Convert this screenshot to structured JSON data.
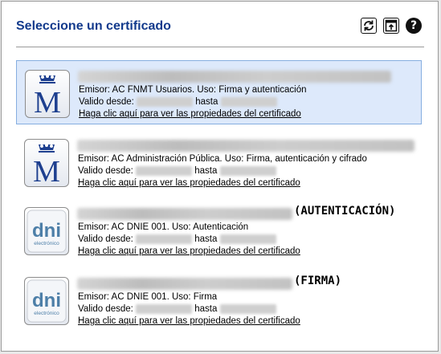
{
  "header": {
    "title": "Seleccione un certificado",
    "icons": [
      "refresh-icon",
      "export-icon",
      "help-icon"
    ],
    "help_glyph": "?"
  },
  "certificates": [
    {
      "issuer_line": "Emisor: AC FNMT Usuarios. Uso: Firma y autenticación",
      "valid_from_label": "Valido desde:",
      "until_label": "hasta",
      "link": "Haga clic aquí para ver las propiedades del certificado",
      "suffix": "",
      "badge": "fnmt-logo",
      "selected": true
    },
    {
      "issuer_line": "Emisor: AC Administración Pública. Uso: Firma, autenticación y cifrado",
      "valid_from_label": "Valido desde:",
      "until_label": "hasta",
      "link": "Haga clic aquí para ver las propiedades del certificado",
      "suffix": "",
      "badge": "fnmt-logo",
      "selected": false
    },
    {
      "issuer_line": "Emisor: AC DNIE 001. Uso: Autenticación",
      "valid_from_label": "Valido desde:",
      "until_label": "hasta",
      "link": "Haga clic aquí para ver las propiedades del certificado",
      "suffix": "(AUTENTICACIÓN)",
      "badge": "dni-logo",
      "badge_text": "dni",
      "badge_subtext": "electrónico",
      "selected": false
    },
    {
      "issuer_line": "Emisor: AC DNIE 001. Uso: Firma",
      "valid_from_label": "Valido desde:",
      "until_label": "hasta",
      "link": "Haga clic aquí para ver las propiedades del certificado",
      "suffix": "(FIRMA)",
      "badge": "dni-logo",
      "badge_text": "dni",
      "badge_subtext": "electrónico",
      "selected": false
    }
  ],
  "colors": {
    "title": "#123a8c",
    "selected_bg": "#dde9fb",
    "selected_border": "#86aee0",
    "fnmt_blue": "#1d3f8f"
  }
}
